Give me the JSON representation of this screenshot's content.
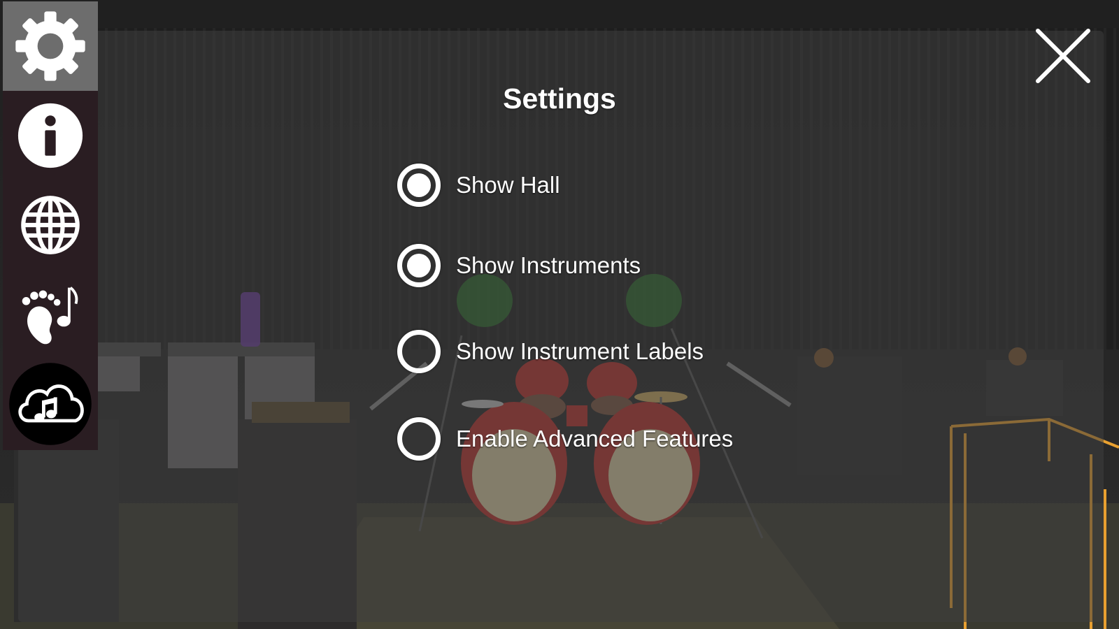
{
  "sidebar": {
    "items": [
      {
        "icon": "gear-icon",
        "active": true
      },
      {
        "icon": "info-icon",
        "active": false
      },
      {
        "icon": "globe-icon",
        "active": false
      },
      {
        "icon": "footprint-music-icon",
        "active": false
      },
      {
        "icon": "music-cloud-icon",
        "active": false
      }
    ]
  },
  "settings": {
    "title": "Settings",
    "options": [
      {
        "label": "Show Hall",
        "checked": true
      },
      {
        "label": "Show Instruments",
        "checked": true
      },
      {
        "label": "Show Instrument Labels",
        "checked": false
      },
      {
        "label": "Enable Advanced Features",
        "checked": false
      }
    ]
  },
  "close": {
    "icon": "close-icon"
  },
  "colors": {
    "sidebar_bg": "#2a1d22",
    "active_bg": "#6d6d6d",
    "text": "#ffffff",
    "drum_red": "#b8302c",
    "drum_head": "#d8cba0",
    "guide_orange": "#e8a030"
  }
}
